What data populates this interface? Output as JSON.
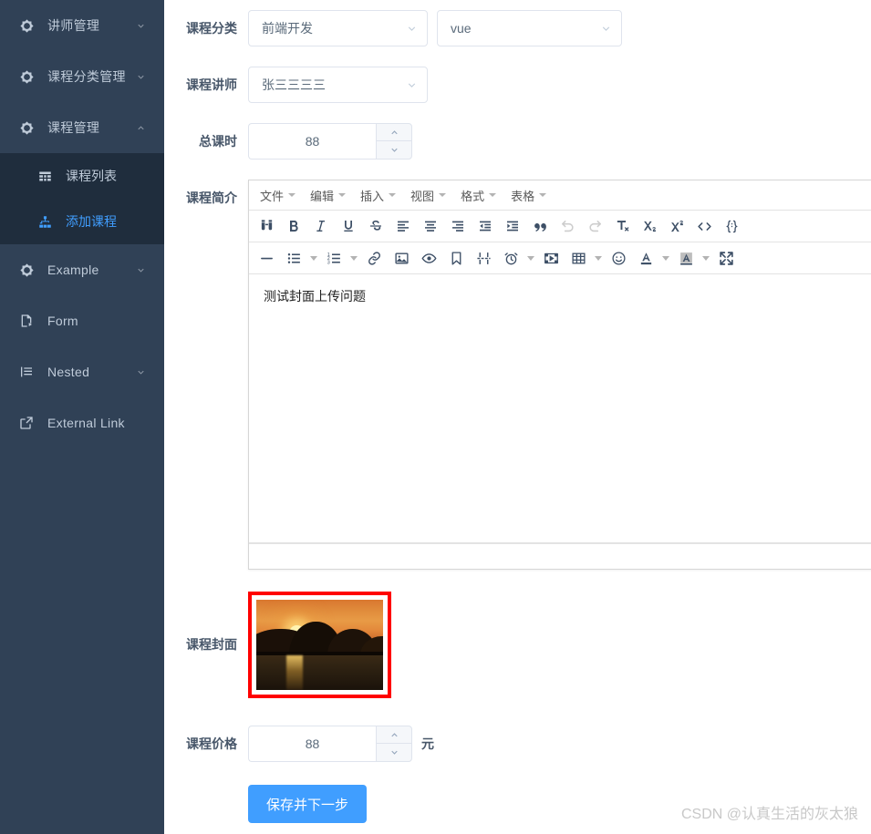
{
  "sidebar": {
    "bg_color": "#304156",
    "active_color": "#409eff",
    "items": [
      {
        "label": "讲师管理",
        "icon": "octagon-icon",
        "has_arrow": true,
        "expanded": false
      },
      {
        "label": "课程分类管理",
        "icon": "octagon-icon",
        "has_arrow": true,
        "expanded": false
      },
      {
        "label": "课程管理",
        "icon": "octagon-icon",
        "has_arrow": true,
        "expanded": true
      },
      {
        "label": "Example",
        "icon": "octagon-icon",
        "has_arrow": true,
        "expanded": false
      },
      {
        "label": "Form",
        "icon": "form-icon",
        "has_arrow": false,
        "expanded": false
      },
      {
        "label": "Nested",
        "icon": "nested-list-icon",
        "has_arrow": true,
        "expanded": false
      },
      {
        "label": "External Link",
        "icon": "external-link-icon",
        "has_arrow": false,
        "expanded": false
      }
    ],
    "submenu": [
      {
        "label": "课程列表",
        "icon": "table-grid-icon",
        "active": false
      },
      {
        "label": "添加课程",
        "icon": "sitemap-icon",
        "active": true
      }
    ]
  },
  "form": {
    "category": {
      "label": "课程分类",
      "primary_value": "前端开发",
      "secondary_value": "vue"
    },
    "teacher": {
      "label": "课程讲师",
      "value": "张三三三三"
    },
    "lessons": {
      "label": "总课时",
      "value": "88"
    },
    "description": {
      "label": "课程简介"
    },
    "cover": {
      "label": "课程封面",
      "alt": "sunset-over-mountains-and-water"
    },
    "price": {
      "label": "课程价格",
      "value": "88",
      "unit": "元"
    },
    "submit_label": "保存并下一步"
  },
  "editor": {
    "menus": [
      "文件",
      "编辑",
      "插入",
      "视图",
      "格式",
      "表格"
    ],
    "toolbar_row1": [
      {
        "name": "search-replace-icon",
        "disabled": false
      },
      {
        "name": "bold-icon",
        "disabled": false
      },
      {
        "name": "italic-icon",
        "disabled": false
      },
      {
        "name": "underline-icon",
        "disabled": false
      },
      {
        "name": "strikethrough-icon",
        "disabled": false
      },
      {
        "name": "align-left-icon",
        "disabled": false
      },
      {
        "name": "align-center-icon",
        "disabled": false
      },
      {
        "name": "align-right-icon",
        "disabled": false
      },
      {
        "name": "outdent-icon",
        "disabled": false
      },
      {
        "name": "indent-icon",
        "disabled": false
      },
      {
        "name": "blockquote-icon",
        "disabled": false
      },
      {
        "name": "undo-icon",
        "disabled": true
      },
      {
        "name": "redo-icon",
        "disabled": true
      },
      {
        "name": "remove-format-icon",
        "disabled": false
      },
      {
        "name": "subscript-icon",
        "disabled": false
      },
      {
        "name": "superscript-icon",
        "disabled": false
      },
      {
        "name": "code-icon",
        "disabled": false
      },
      {
        "name": "source-code-icon",
        "disabled": false
      }
    ],
    "toolbar_row2": [
      {
        "name": "horizontal-rule-icon",
        "caret": false
      },
      {
        "name": "bullet-list-icon",
        "caret": true
      },
      {
        "name": "numbered-list-icon",
        "caret": true
      },
      {
        "name": "link-icon",
        "caret": false
      },
      {
        "name": "image-icon",
        "caret": false
      },
      {
        "name": "preview-icon",
        "caret": false
      },
      {
        "name": "anchor-icon",
        "caret": false
      },
      {
        "name": "page-break-icon",
        "caret": false
      },
      {
        "name": "insert-datetime-icon",
        "caret": true
      },
      {
        "name": "media-icon",
        "caret": false
      },
      {
        "name": "table-icon",
        "caret": true
      },
      {
        "name": "emoticons-icon",
        "caret": false
      },
      {
        "name": "text-color-icon",
        "caret": true
      },
      {
        "name": "background-color-icon",
        "caret": true
      },
      {
        "name": "fullscreen-icon",
        "caret": false
      }
    ],
    "content": "测试封面上传问题"
  },
  "watermark": "CSDN @认真生活的灰太狼"
}
